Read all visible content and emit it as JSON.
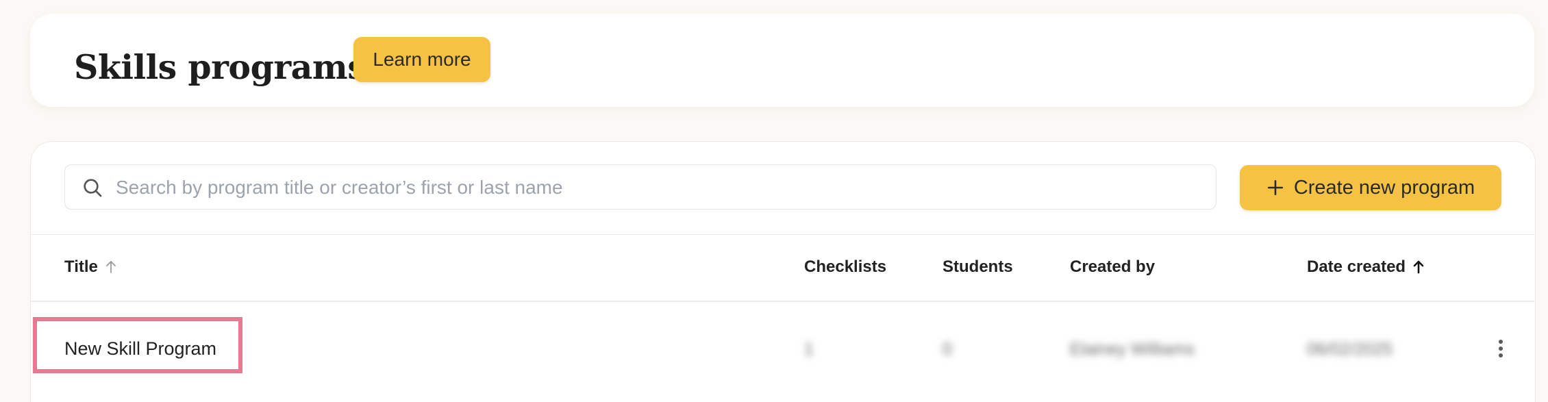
{
  "header": {
    "title": "Skills programs",
    "learn_more_label": "Learn more"
  },
  "search": {
    "placeholder": "Search by program title or creator’s first or last name",
    "value": ""
  },
  "actions": {
    "create_label": "Create new program"
  },
  "table": {
    "columns": [
      {
        "label": "Title",
        "sort": "ascending-inactive"
      },
      {
        "label": "Checklists"
      },
      {
        "label": "Students"
      },
      {
        "label": "Created by"
      },
      {
        "label": "Date created",
        "sort": "ascending-active"
      }
    ],
    "rows": [
      {
        "title": "New Skill Program",
        "checklists": "1",
        "students": "0",
        "created_by": "Elainey Williams",
        "date_created": "06/02/2025"
      }
    ]
  },
  "colors": {
    "accent": "#f6c244",
    "highlight_border": "#e47b93",
    "background": "#fbf9f6"
  }
}
